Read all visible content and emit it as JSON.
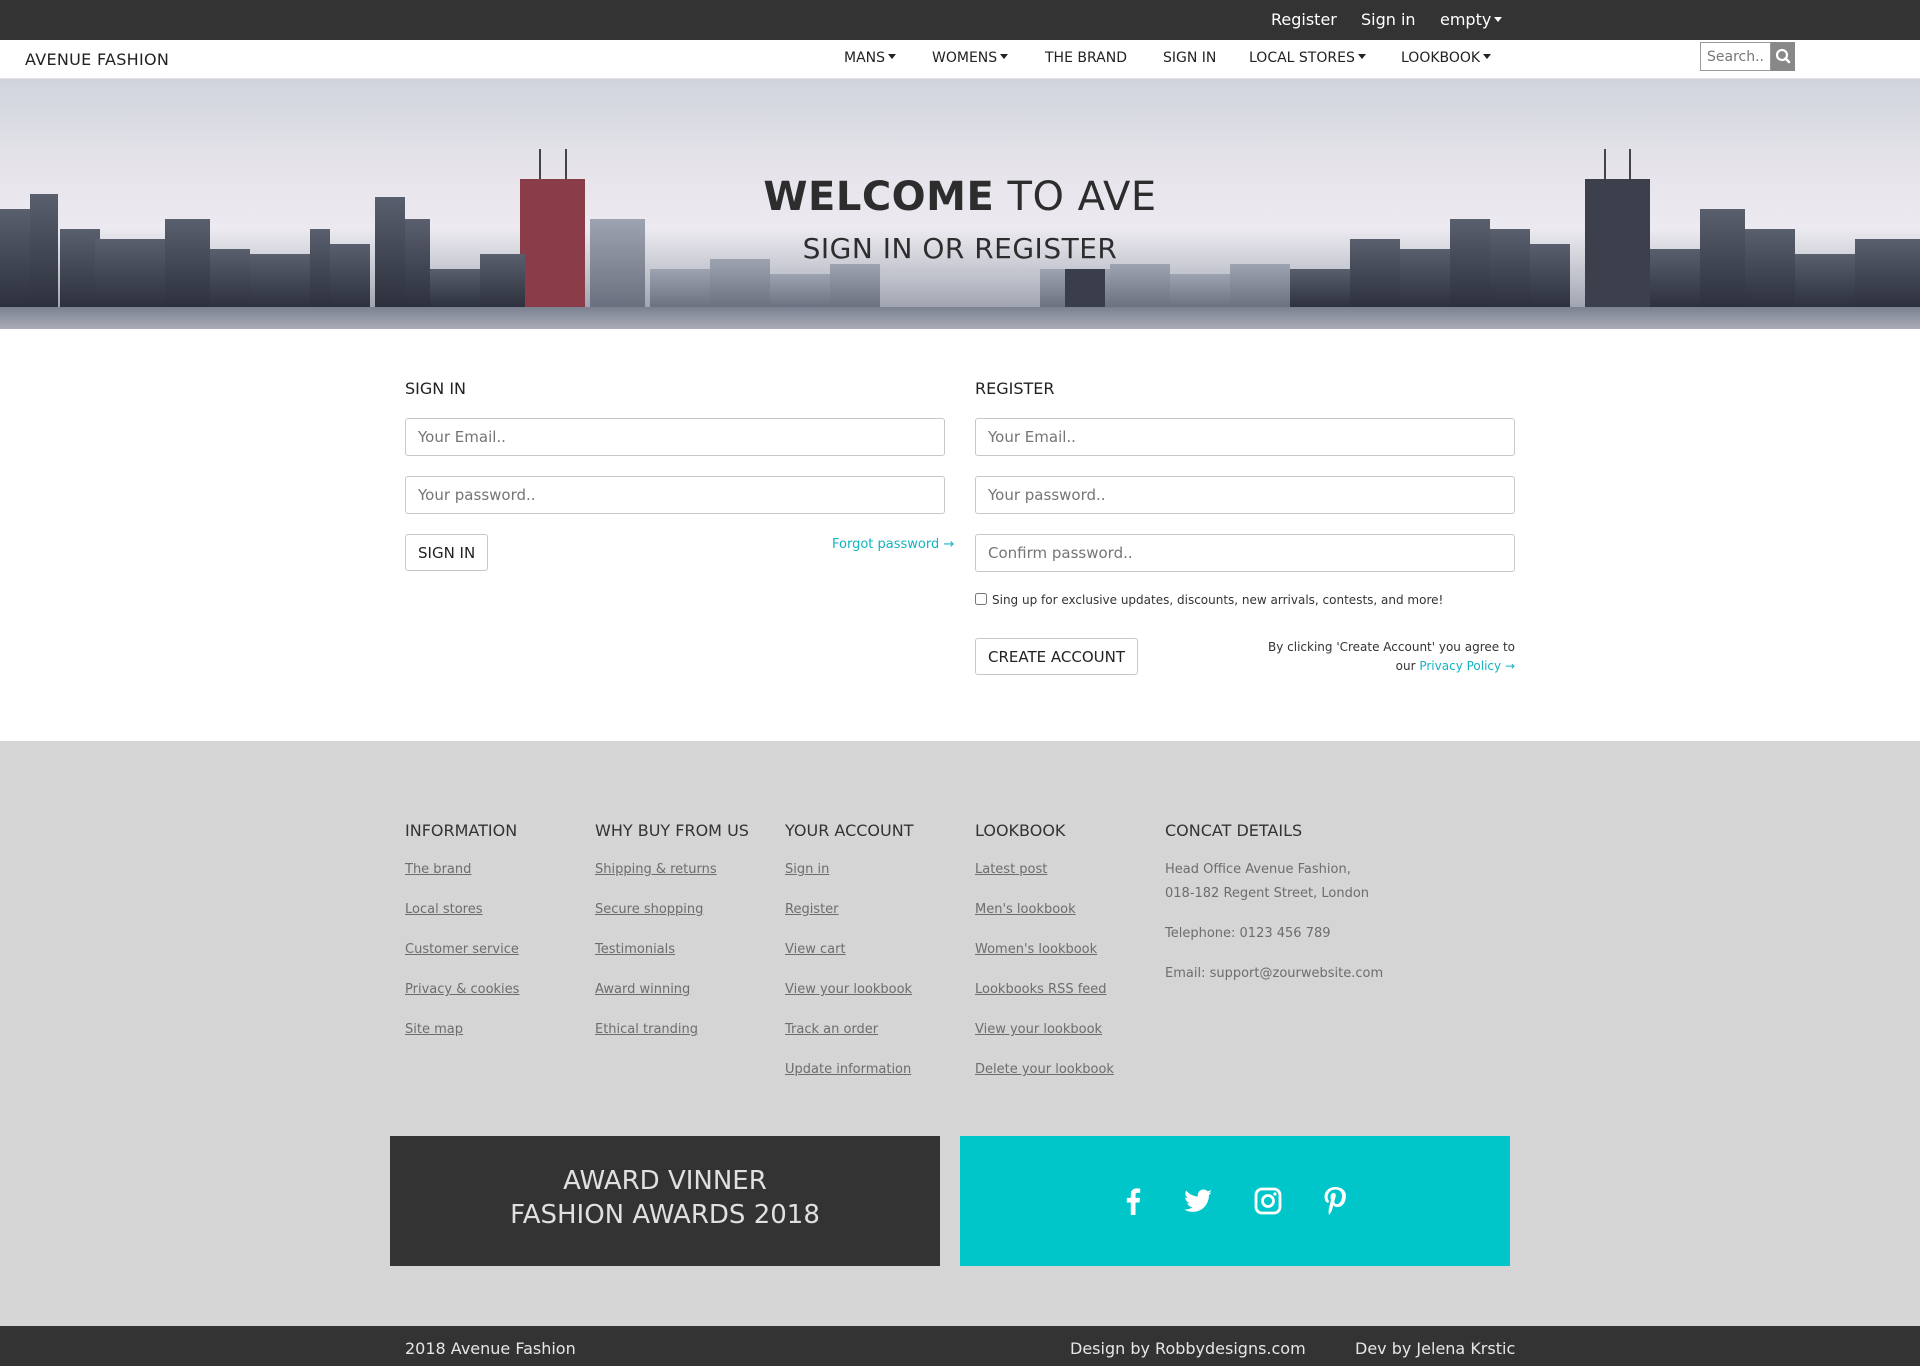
{
  "topbar": {
    "register": "Register",
    "sign_in": "Sign in",
    "cart": "empty"
  },
  "navbar": {
    "brand": "AVENUE FASHION",
    "items": [
      "MANS",
      "WOMENS",
      "THE BRAND",
      "SIGN IN",
      "LOCAL STORES",
      "LOOKBOOK"
    ],
    "search_placeholder": "Search.."
  },
  "hero": {
    "title_bold": "WELCOME",
    "title_rest": "TO AVE",
    "subtitle": "SIGN IN OR REGISTER"
  },
  "sign_in": {
    "title": "SIGN IN",
    "email_placeholder": "Your Email..",
    "password_placeholder": "Your password..",
    "button": "SIGN IN",
    "forgot": "Forgot password →"
  },
  "register": {
    "title": "REGISTER",
    "email_placeholder": "Your Email..",
    "password_placeholder": "Your password..",
    "confirm_placeholder": "Confirm password..",
    "newsletter": "Sing up for exclusive updates, discounts, new arrivals, contests, and more!",
    "button": "CREATE ACCOUNT",
    "agree_line1": "By clicking 'Create Account' you agree to",
    "agree_prefix": "our",
    "privacy_link": "Privacy Policy →"
  },
  "footer": {
    "columns": [
      {
        "title": "INFORMATION",
        "links": [
          "The brand",
          "Local stores",
          "Customer service",
          "Privacy & cookies",
          "Site map"
        ]
      },
      {
        "title": "WHY BUY FROM US",
        "links": [
          "Shipping & returns",
          "Secure shopping",
          "Testimonials",
          "Award winning",
          "Ethical tranding"
        ]
      },
      {
        "title": "YOUR ACCOUNT",
        "links": [
          "Sign in",
          "Register",
          "View cart",
          "View your lookbook",
          "Track an order",
          "Update information"
        ]
      },
      {
        "title": "LOOKBOOK",
        "links": [
          "Latest post",
          "Men's lookbook",
          "Women's lookbook",
          "Lookbooks RSS feed",
          "View your lookbook",
          "Delete your lookbook"
        ]
      }
    ],
    "contact": {
      "title": "CONCAT DETAILS",
      "address_line1": "Head Office Avenue Fashion,",
      "address_line2": "018-182 Regent Street, London",
      "telephone": "Telephone: 0123 456 789",
      "email": "Email: support@zourwebsite.com"
    },
    "award_line1": "AWARD VINNER",
    "award_line2": "FASHION AWARDS 2018",
    "social_icons": [
      "facebook-icon",
      "twitter-icon",
      "instagram-icon",
      "pinterest-icon"
    ],
    "social_color": "#00c6c9"
  },
  "bottom": {
    "copyright": "2018 Avenue Fashion",
    "design": "Design by Robbydesigns.com",
    "dev": "Dev by Jelena Krstic"
  }
}
